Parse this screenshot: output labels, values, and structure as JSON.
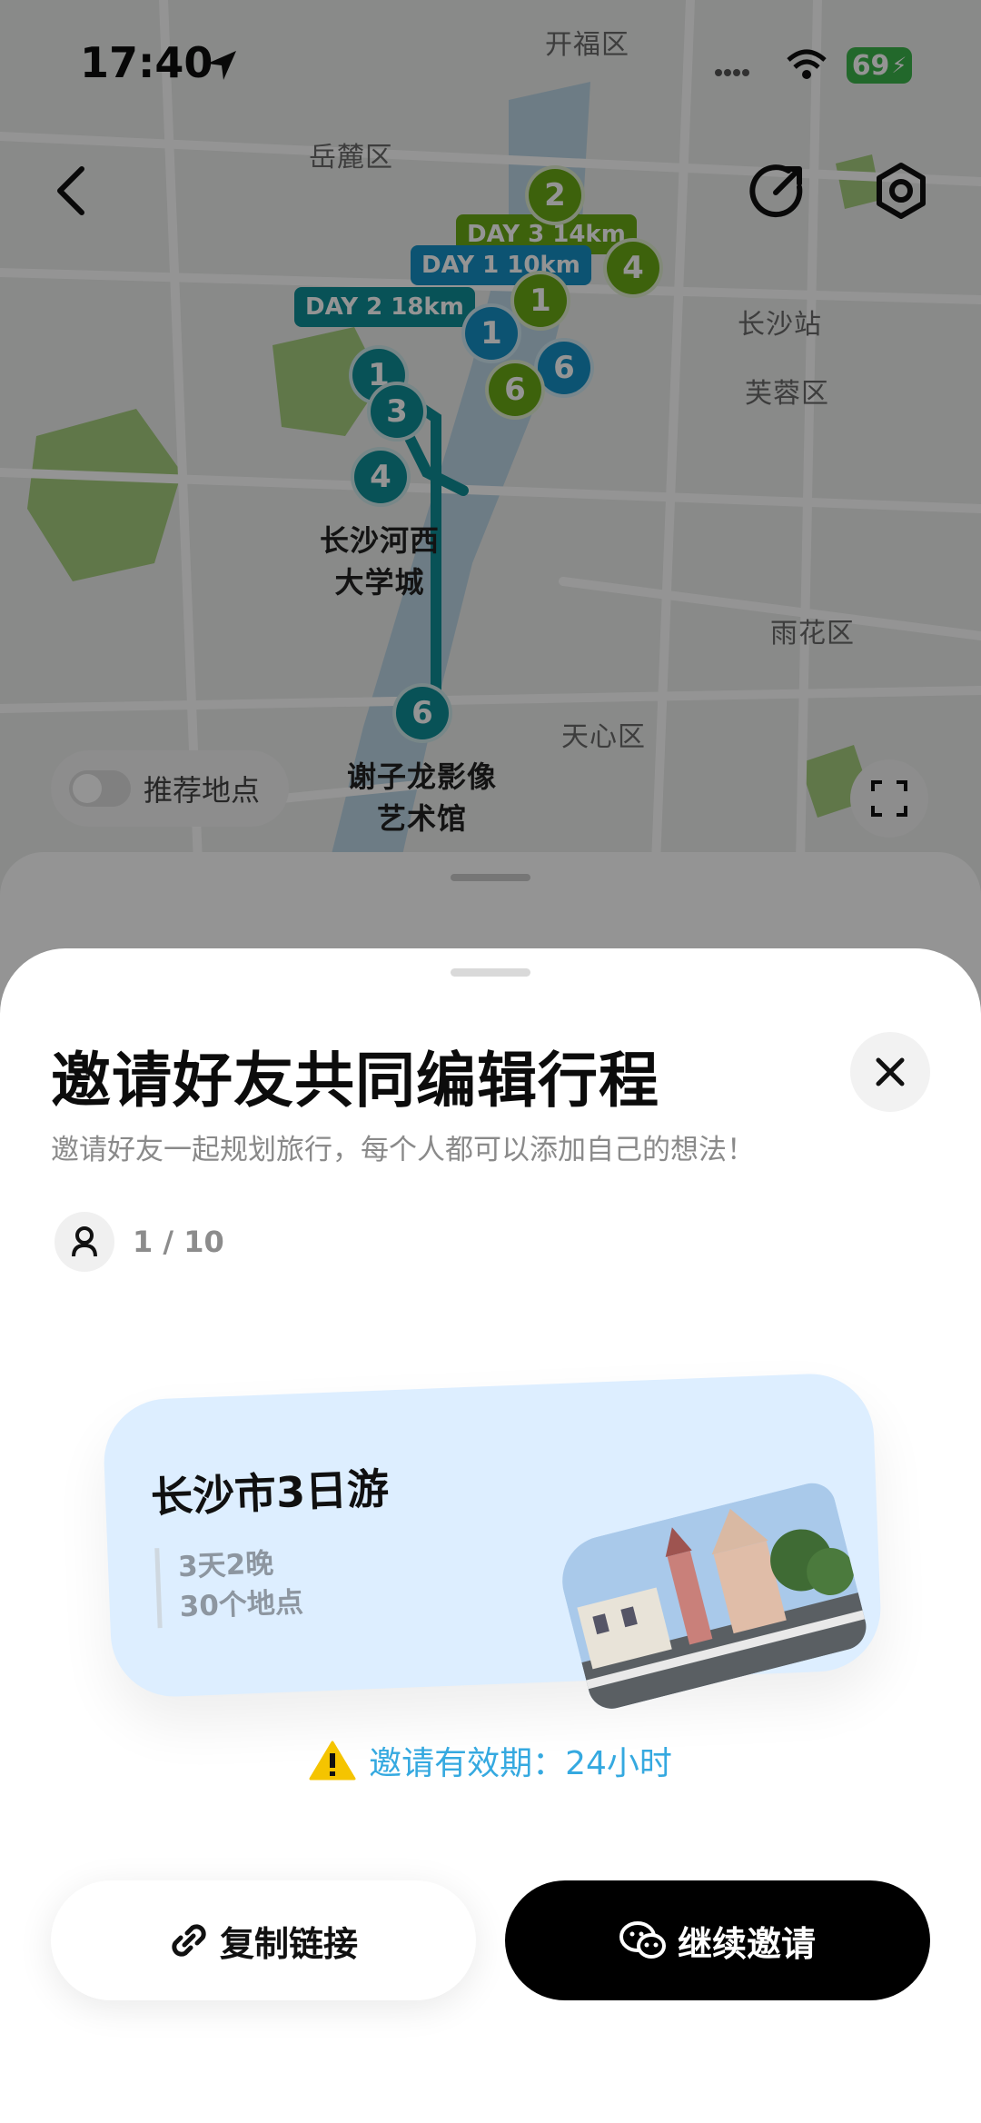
{
  "status_bar": {
    "time": "17:40",
    "battery": "69"
  },
  "map": {
    "district_labels": [
      "岳麓区",
      "长沙站",
      "芙蓉区",
      "雨花区",
      "天心区",
      "开福区"
    ],
    "poi_labels": [
      "长沙河西\n大学城",
      "谢子龙影像\n艺术馆"
    ],
    "day_tags": [
      {
        "label": "DAY 3 14km",
        "color": "#6aaa16"
      },
      {
        "label": "DAY 1 10km",
        "color": "#1690c4"
      },
      {
        "label": "DAY 2 18km",
        "color": "#0f8d96"
      }
    ],
    "pins": [
      "2",
      "4",
      "1",
      "1",
      "6",
      "6",
      "1",
      "3",
      "4",
      "6"
    ],
    "recommend_toggle_label": "推荐地点"
  },
  "sheet": {
    "title": "邀请好友共同编辑行程",
    "subtitle": "邀请好友一起规划旅行，每个人都可以添加自己的想法！",
    "member_count": "1 / 10",
    "trip": {
      "title": "长沙市3日游",
      "duration": "3天2晚",
      "places": "30个地点"
    },
    "validity": "邀请有效期：24小时",
    "copy_link_label": "复制链接",
    "continue_invite_label": "继续邀请"
  },
  "colors": {
    "accent_blue": "#35a9e0",
    "card_bg": "#ddeeff",
    "warning": "#f5c400"
  }
}
